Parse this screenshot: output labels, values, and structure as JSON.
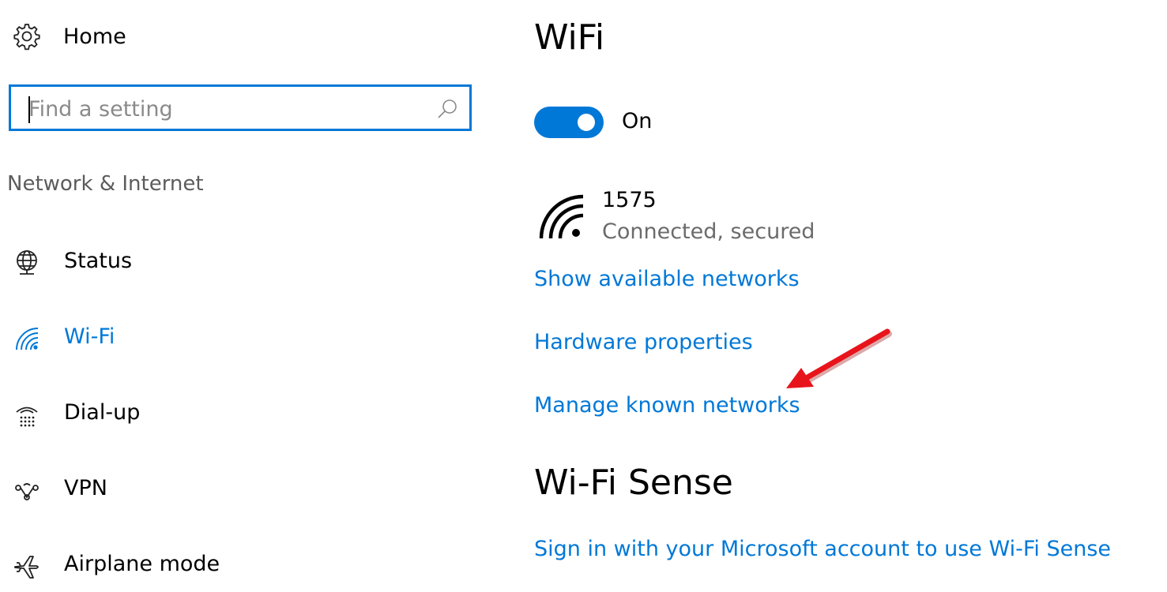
{
  "sidebar": {
    "home_label": "Home",
    "search": {
      "placeholder": "Find a setting",
      "value": ""
    },
    "group_label": "Network & Internet",
    "items": [
      {
        "label": "Status",
        "icon": "globe-icon"
      },
      {
        "label": "Wi-Fi",
        "icon": "wifi-icon",
        "active": true
      },
      {
        "label": "Dial-up",
        "icon": "dialup-icon"
      },
      {
        "label": "VPN",
        "icon": "vpn-icon"
      },
      {
        "label": "Airplane mode",
        "icon": "airplane-icon"
      }
    ]
  },
  "main": {
    "title": "WiFi",
    "toggle": {
      "state": "On",
      "on": true
    },
    "network": {
      "name": "1575",
      "status": "Connected, secured"
    },
    "links": {
      "show_networks": "Show available networks",
      "hardware": "Hardware properties",
      "manage": "Manage known networks"
    },
    "sense": {
      "title": "Wi-Fi Sense",
      "link": "Sign in with your Microsoft account to use Wi-Fi Sense"
    }
  },
  "colors": {
    "accent": "#0078d7",
    "annotation_arrow": "#e8141b"
  }
}
